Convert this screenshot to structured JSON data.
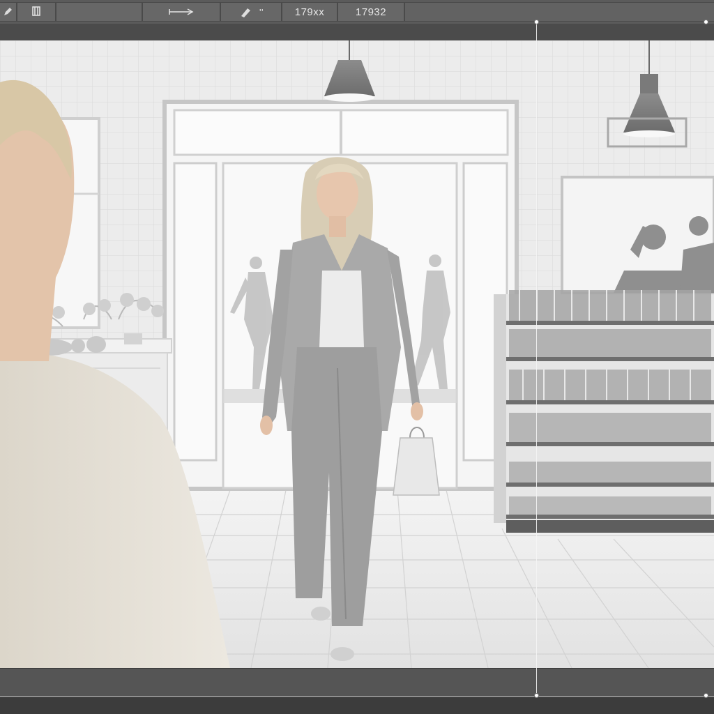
{
  "toolbar": {
    "tools": [
      {
        "icon": "pen-icon"
      },
      {
        "icon": "layers-icon"
      },
      {
        "icon": "arrow-right-icon"
      },
      {
        "icon": "brush-icon",
        "label": "''"
      },
      {
        "label": "179xx"
      },
      {
        "label": "17932"
      }
    ]
  },
  "canvas": {
    "scene_icons": [
      "pendant-lamp-icon",
      "shelf-icon",
      "shopping-bag-icon"
    ]
  },
  "colors": {
    "toolbar_bg": "#5b5b5b",
    "toolbar_segment": "#676767",
    "canvas_bg": "#eeeeee",
    "guide_line": "#f4f4f4"
  }
}
